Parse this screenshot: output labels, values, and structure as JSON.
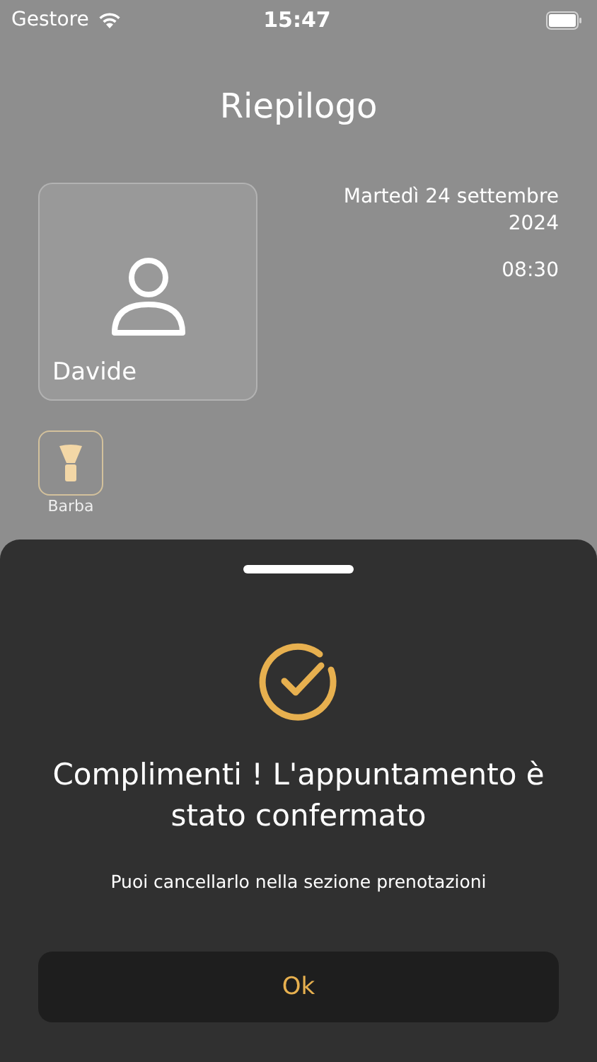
{
  "status_bar": {
    "carrier": "Gestore",
    "time": "15:47"
  },
  "title": "Riepilogo",
  "staff": {
    "name": "Davide"
  },
  "appointment": {
    "date": "Martedì 24 settembre 2024",
    "time": "08:30"
  },
  "services": [
    {
      "label": "Barba"
    }
  ],
  "sheet": {
    "heading": "Complimenti ! L'appuntamento è stato confermato",
    "message": "Puoi cancellarlo nella sezione prenotazioni",
    "button": "Ok"
  }
}
